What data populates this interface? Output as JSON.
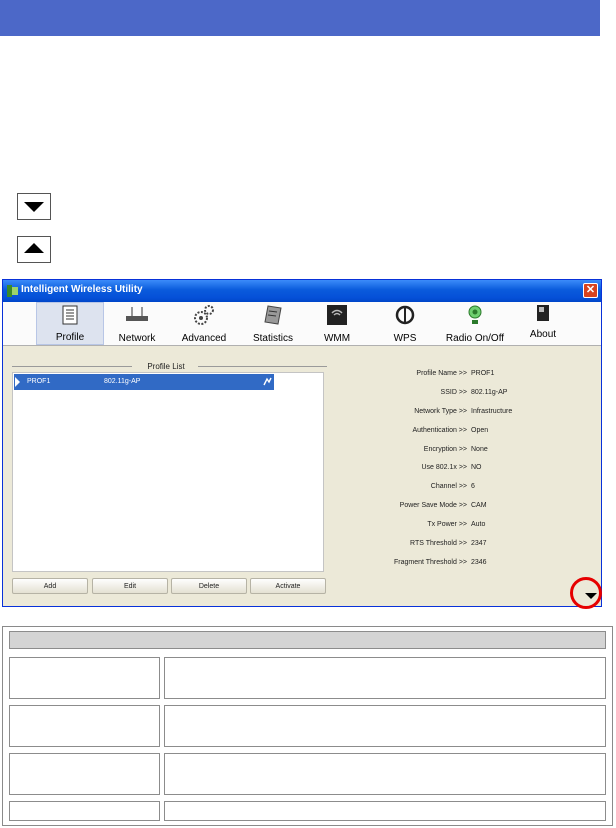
{
  "window": {
    "title": "Intelligent Wireless Utility",
    "close_glyph": "✕"
  },
  "toolbar": {
    "items": [
      {
        "label": "Profile",
        "icon": "profile-icon"
      },
      {
        "label": "Network",
        "icon": "network-icon"
      },
      {
        "label": "Advanced",
        "icon": "advanced-icon"
      },
      {
        "label": "Statistics",
        "icon": "statistics-icon"
      },
      {
        "label": "WMM",
        "icon": "wmm-icon"
      },
      {
        "label": "WPS",
        "icon": "wps-icon"
      },
      {
        "label": "Radio On/Off",
        "icon": "radio-icon"
      },
      {
        "label": "About",
        "icon": "about-icon"
      }
    ]
  },
  "profile_list": {
    "label": "Profile List",
    "rows": [
      {
        "name": "PROF1",
        "ssid": "802.11g-AP"
      }
    ]
  },
  "buttons": {
    "add": "Add",
    "edit": "Edit",
    "delete": "Delete",
    "activate": "Activate"
  },
  "details": [
    {
      "label": "Profile Name >>",
      "value": "PROF1"
    },
    {
      "label": "SSID >>",
      "value": "802.11g-AP"
    },
    {
      "label": "Network Type >>",
      "value": "Infrastructure"
    },
    {
      "label": "Authentication >>",
      "value": "Open"
    },
    {
      "label": "Encryption >>",
      "value": "None"
    },
    {
      "label": "Use 802.1x >>",
      "value": "NO"
    },
    {
      "label": "Channel >>",
      "value": "6"
    },
    {
      "label": "Power Save Mode >>",
      "value": "CAM"
    },
    {
      "label": "Tx Power >>",
      "value": "Auto"
    },
    {
      "label": "RTS Threshold >>",
      "value": "2347"
    },
    {
      "label": "Fragment Threshold >>",
      "value": "2346"
    }
  ],
  "colors": {
    "header_bar": "#4c68c8",
    "selection": "#316ac5",
    "highlight_circle": "#e60000"
  }
}
